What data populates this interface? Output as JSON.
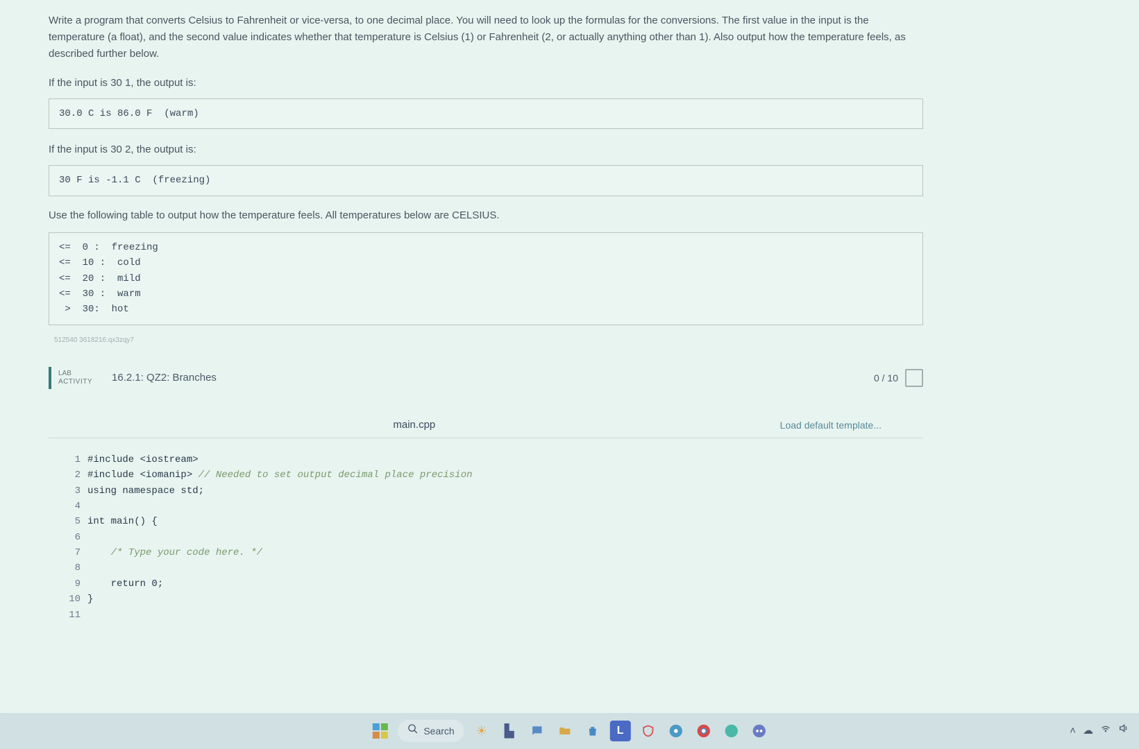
{
  "problem": {
    "description": "Write a program that converts Celsius to Fahrenheit or vice-versa, to one decimal place. You will need to look up the formulas for the conversions. The first value in the input is the temperature (a float), and the second value indicates whether that temperature is Celsius (1) or Fahrenheit (2, or actually anything other than 1). Also output how the temperature feels, as described further below.",
    "example1_label": "If the input is 30 1, the output is:",
    "example1_output": "30.0 C is 86.0 F  (warm)",
    "example2_label": "If the input is 30 2, the output is:",
    "example2_output": "30 F is -1.1 C  (freezing)",
    "table_label": "Use the following table to output how the temperature feels. All temperatures below are CELSIUS.",
    "table_text": "<=  0 :  freezing\n<=  10 :  cold\n<=  20 :  mild\n<=  30 :  warm\n >  30:  hot"
  },
  "lab": {
    "activity_line1": "LAB",
    "activity_line2": "ACTIVITY",
    "title": "16.2.1: QZ2: Branches",
    "score": "0 / 10"
  },
  "editor": {
    "filename": "main.cpp",
    "load_template": "Load default template...",
    "lines": [
      {
        "n": "1",
        "code": "#include <iostream>"
      },
      {
        "n": "2",
        "code": "#include <iomanip> ",
        "comment": "// Needed to set output decimal place precision"
      },
      {
        "n": "3",
        "code": "using namespace std;"
      },
      {
        "n": "4",
        "code": ""
      },
      {
        "n": "5",
        "code": "int main() {"
      },
      {
        "n": "6",
        "code": ""
      },
      {
        "n": "7",
        "code": "    ",
        "comment": "/* Type your code here. */"
      },
      {
        "n": "8",
        "code": ""
      },
      {
        "n": "9",
        "code": "    return 0;"
      },
      {
        "n": "10",
        "code": "}"
      },
      {
        "n": "11",
        "code": ""
      }
    ]
  },
  "taskbar": {
    "search_placeholder": "Search"
  }
}
